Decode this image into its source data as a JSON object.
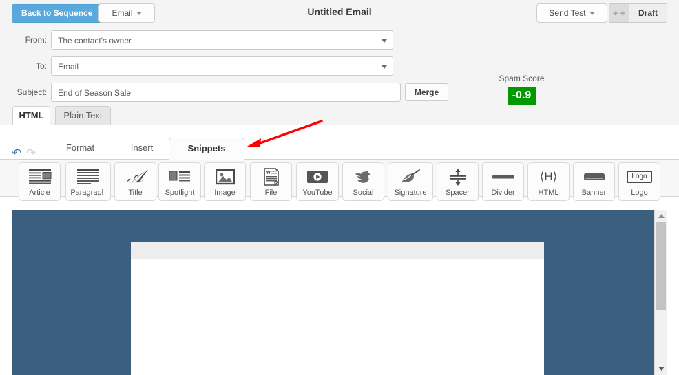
{
  "topbar": {
    "back_button": "Back to Sequence",
    "type_dropdown": "Email",
    "document_title": "Untitled Email",
    "send_test": "Send Test",
    "status": "Draft",
    "accent_blue": "#5aa9dd"
  },
  "form": {
    "from_label": "From:",
    "from_value": "The contact's owner",
    "to_label": "To:",
    "to_value": "Email",
    "subject_label": "Subject:",
    "subject_value": "End of Season Sale",
    "merge_button": "Merge"
  },
  "spam": {
    "title": "Spam Score",
    "score": "-0.9",
    "badge_color": "#009900"
  },
  "content_tabs": [
    {
      "label": "HTML",
      "active": true
    },
    {
      "label": "Plain Text",
      "active": false
    }
  ],
  "editor": {
    "undo_icon": "undo-arrow",
    "redo_icon": "redo-arrow",
    "tabs": [
      {
        "label": "Format",
        "active": false
      },
      {
        "label": "Insert",
        "active": false
      },
      {
        "label": "Snippets",
        "active": true
      }
    ]
  },
  "snippets": [
    {
      "label": "Article",
      "icon": "article-icon"
    },
    {
      "label": "Paragraph",
      "icon": "paragraph-icon"
    },
    {
      "label": "Title",
      "icon": "title-script-a-icon"
    },
    {
      "label": "Spotlight",
      "icon": "spotlight-icon"
    },
    {
      "label": "Image",
      "icon": "image-icon"
    },
    {
      "label": "File",
      "icon": "file-document-icon"
    },
    {
      "label": "YouTube",
      "icon": "youtube-play-icon"
    },
    {
      "label": "Social",
      "icon": "social-bird-icon"
    },
    {
      "label": "Signature",
      "icon": "signature-quill-icon"
    },
    {
      "label": "Spacer",
      "icon": "spacer-arrows-icon"
    },
    {
      "label": "Divider",
      "icon": "divider-bar-icon"
    },
    {
      "label": "HTML",
      "icon": "html-brackets-icon"
    },
    {
      "label": "Banner",
      "icon": "banner-icon"
    },
    {
      "label": "Logo",
      "icon": "logo-box-icon",
      "glyph": "Logo"
    }
  ],
  "canvas": {
    "background_color": "#3b5f7e",
    "body_color": "#ffffff",
    "body_header_color": "#ededed"
  },
  "annotation": {
    "type": "red-arrow",
    "color": "#ff0000",
    "points_to": "Snippets"
  }
}
